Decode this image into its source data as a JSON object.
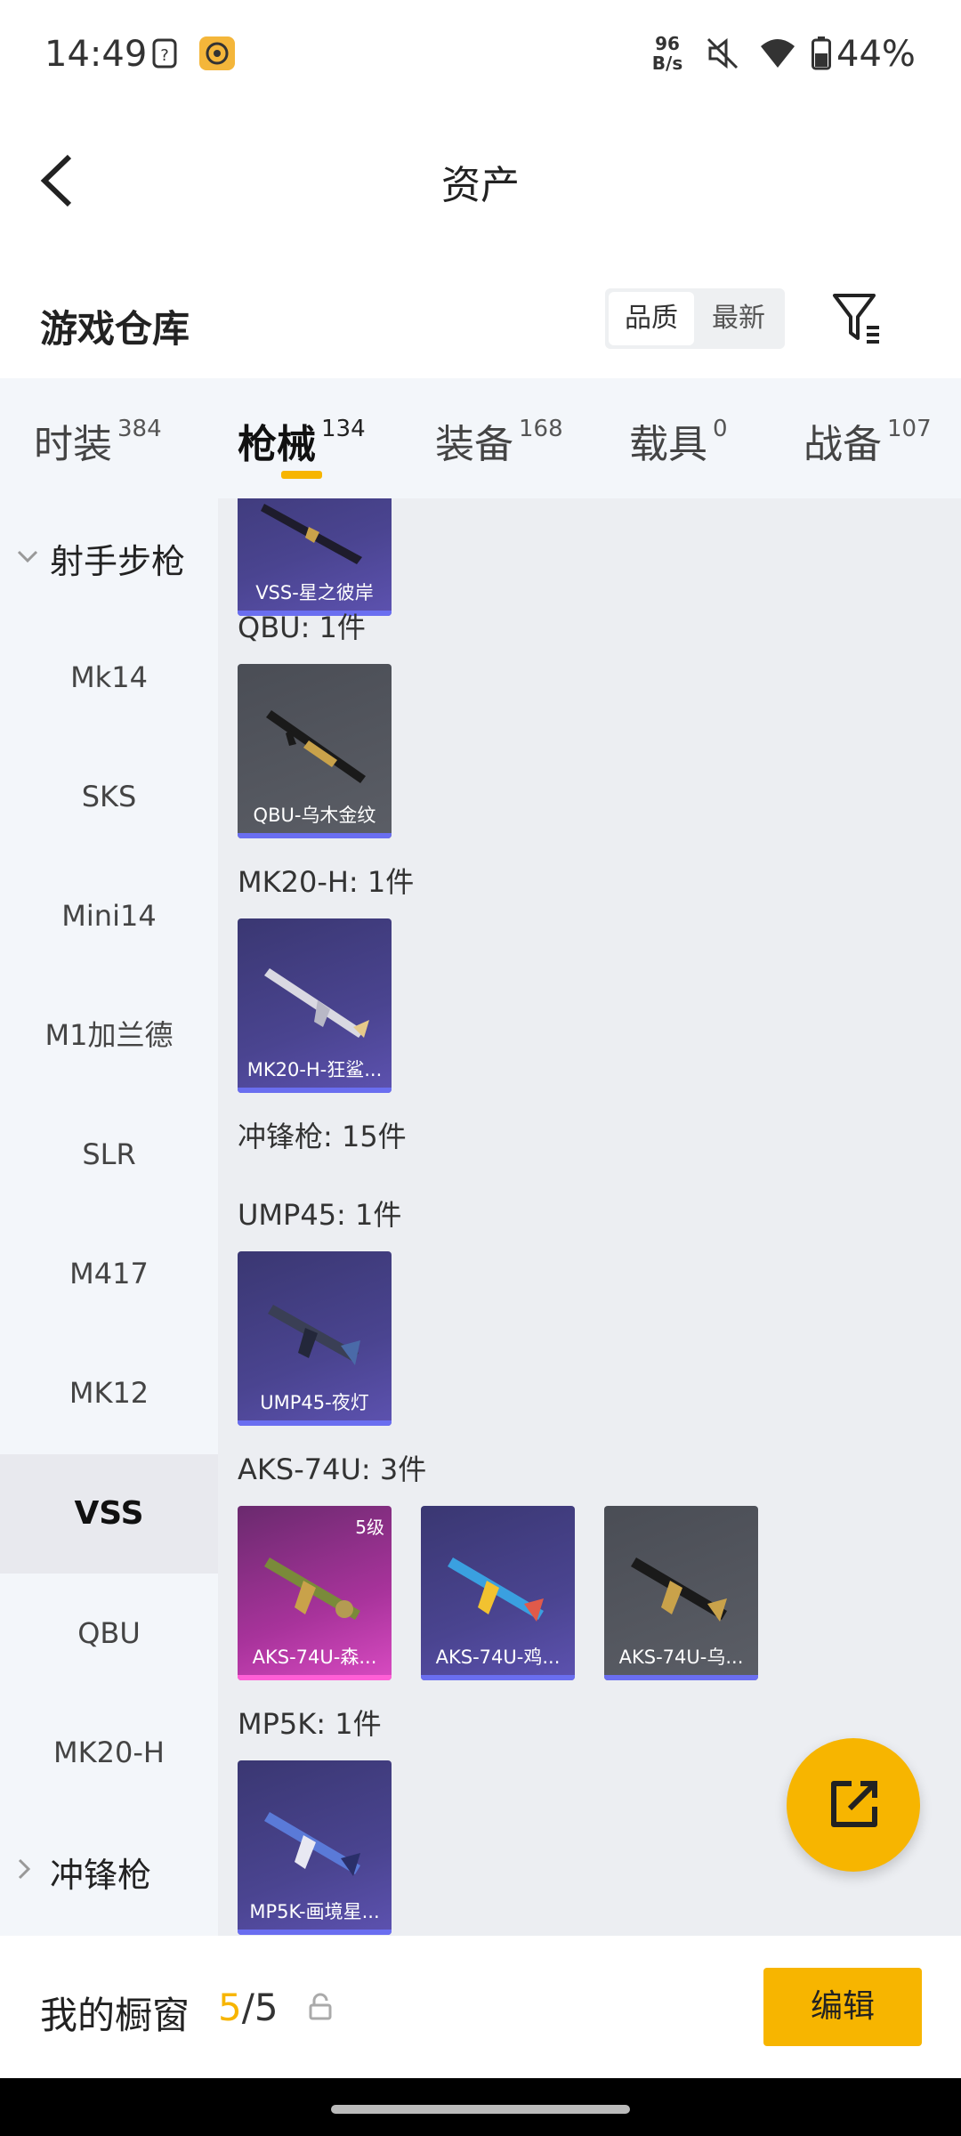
{
  "status_bar": {
    "time": "14:49",
    "net_speed_value": "96",
    "net_speed_unit": "B/s",
    "battery": "44%"
  },
  "header": {
    "title": "资产",
    "back_icon": "chevron-left-icon"
  },
  "section": {
    "title": "游戏仓库",
    "sort_options": [
      "品质",
      "最新"
    ],
    "filter_icon": "filter-icon"
  },
  "tabs": [
    {
      "label": "时装",
      "count": "384"
    },
    {
      "label": "枪械",
      "count": "134"
    },
    {
      "label": "装备",
      "count": "168"
    },
    {
      "label": "载具",
      "count": "0"
    },
    {
      "label": "战备",
      "count": "107"
    }
  ],
  "sidebar": {
    "category_open": "射手步枪",
    "items": [
      "Mk14",
      "SKS",
      "Mini14",
      "M1加兰德",
      "SLR",
      "M417",
      "MK12",
      "VSS",
      "QBU",
      "MK20-H"
    ],
    "category_closed": "冲锋枪"
  },
  "content": {
    "top_card": "VSS-星之彼岸",
    "groups": [
      {
        "title": "QBU: 1件",
        "cards": [
          "QBU-乌木金纹"
        ]
      },
      {
        "title": "MK20-H: 1件",
        "cards": [
          "MK20-H-狂鲨..."
        ]
      },
      {
        "title": "冲锋枪: 15件",
        "cards": []
      },
      {
        "title": "UMP45: 1件",
        "cards": [
          "UMP45-夜灯"
        ]
      },
      {
        "title": "AKS-74U: 3件",
        "cards": [
          "AKS-74U-森...",
          "AKS-74U-鸡...",
          "AKS-74U-乌..."
        ],
        "badge": "5级"
      },
      {
        "title": "MP5K: 1件",
        "cards": [
          "MP5K-画境星..."
        ]
      }
    ]
  },
  "fab_icon": "share-external-icon",
  "bottom_bar": {
    "label": "我的橱窗",
    "count_current": "5",
    "count_total": "/5",
    "edit_label": "编辑"
  },
  "colors": {
    "accent": "#f7b500",
    "sidebar_bg": "#f3f6fa",
    "content_bg": "#eceef2",
    "purple_card": "#4a4490",
    "pink_card": "#a8339b"
  }
}
